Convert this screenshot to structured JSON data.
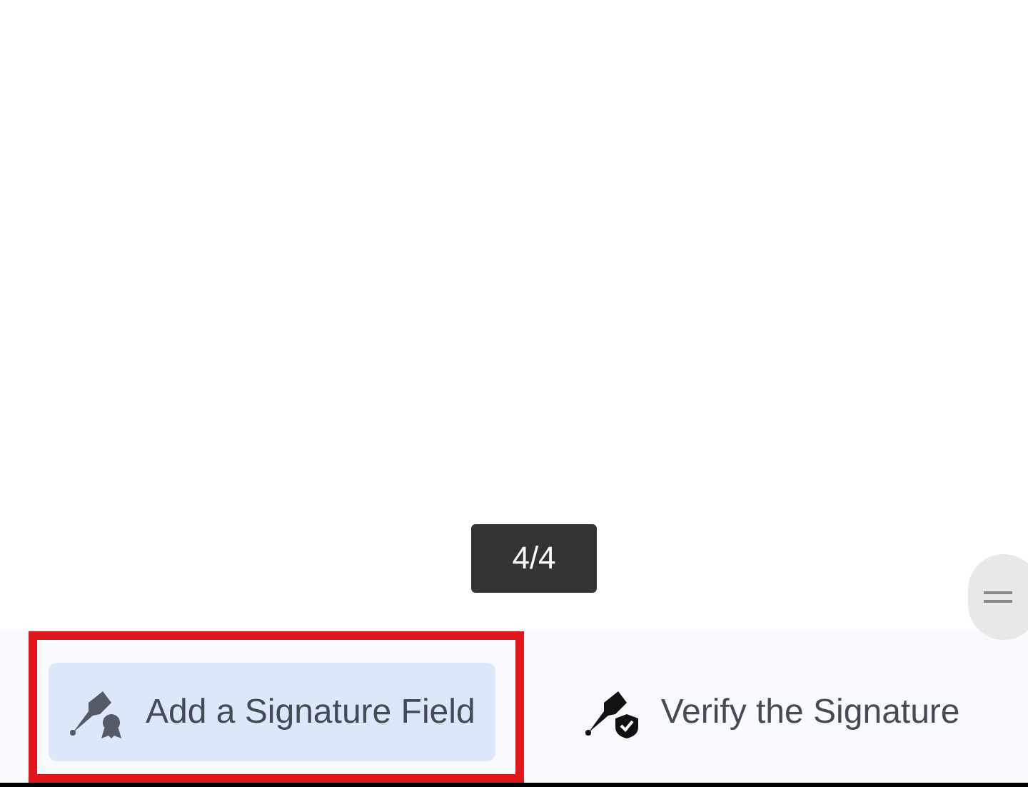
{
  "page_indicator": "4/4",
  "toolbar": {
    "items": [
      {
        "kind": "add-field",
        "label": "Add a Signature Field",
        "selected": true,
        "highlighted": true
      },
      {
        "kind": "verify",
        "label": "Verify the Signature",
        "selected": false,
        "highlighted": false
      }
    ]
  }
}
